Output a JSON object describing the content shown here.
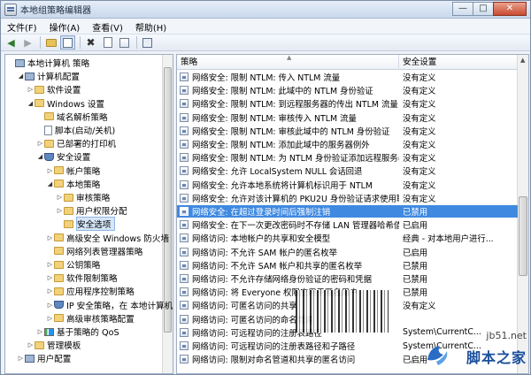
{
  "window": {
    "title": "本地组策略编辑器",
    "controls": {
      "minimize": "—",
      "maximize": "□",
      "close": "✕"
    }
  },
  "menu": [
    "文件(F)",
    "操作(A)",
    "查看(V)",
    "帮助(H)"
  ],
  "toolbar": {
    "icons": [
      "back-arrow-icon",
      "forward-arrow-icon",
      "up-folder-icon",
      "show-tree-icon",
      "delete-icon",
      "properties-icon",
      "export-list-icon",
      "help-icon"
    ]
  },
  "tree": [
    {
      "label": "本地计算机 策略",
      "depth": 0,
      "icon": "computer",
      "expander": ""
    },
    {
      "label": "计算机配置",
      "depth": 1,
      "icon": "computer",
      "expander": "◢"
    },
    {
      "label": "软件设置",
      "depth": 2,
      "icon": "folder",
      "expander": "▷"
    },
    {
      "label": "Windows 设置",
      "depth": 2,
      "icon": "folder",
      "expander": "◢"
    },
    {
      "label": "域名解析策略",
      "depth": 3,
      "icon": "folder",
      "expander": ""
    },
    {
      "label": "脚本(启动/关机)",
      "depth": 3,
      "icon": "doc",
      "expander": ""
    },
    {
      "label": "已部署的打印机",
      "depth": 3,
      "icon": "folder",
      "expander": "▷"
    },
    {
      "label": "安全设置",
      "depth": 3,
      "icon": "shield",
      "expander": "◢"
    },
    {
      "label": "帐户策略",
      "depth": 4,
      "icon": "folder",
      "expander": "▷"
    },
    {
      "label": "本地策略",
      "depth": 4,
      "icon": "folder",
      "expander": "◢"
    },
    {
      "label": "审核策略",
      "depth": 5,
      "icon": "folder",
      "expander": "▷"
    },
    {
      "label": "用户权限分配",
      "depth": 5,
      "icon": "folder",
      "expander": "▷"
    },
    {
      "label": "安全选项",
      "depth": 5,
      "icon": "folder",
      "expander": "",
      "selected": true
    },
    {
      "label": "高级安全 Windows 防火墙",
      "depth": 4,
      "icon": "folder",
      "expander": "▷"
    },
    {
      "label": "网络列表管理器策略",
      "depth": 4,
      "icon": "folder",
      "expander": ""
    },
    {
      "label": "公钥策略",
      "depth": 4,
      "icon": "folder",
      "expander": "▷"
    },
    {
      "label": "软件限制策略",
      "depth": 4,
      "icon": "folder",
      "expander": "▷"
    },
    {
      "label": "应用程序控制策略",
      "depth": 4,
      "icon": "folder",
      "expander": "▷"
    },
    {
      "label": "IP 安全策略，在 本地计算机",
      "depth": 4,
      "icon": "shield",
      "expander": "▷"
    },
    {
      "label": "高级审核策略配置",
      "depth": 4,
      "icon": "folder",
      "expander": "▷"
    },
    {
      "label": "基于策略的 QoS",
      "depth": 3,
      "icon": "chart",
      "expander": "▷"
    },
    {
      "label": "管理模板",
      "depth": 2,
      "icon": "folder",
      "expander": "▷"
    },
    {
      "label": "用户配置",
      "depth": 1,
      "icon": "computer",
      "expander": "▷"
    }
  ],
  "list": {
    "columns": {
      "policy": "策略",
      "setting": "安全设置"
    },
    "rows": [
      {
        "policy": "网络安全: 限制 NTLM: 传入 NTLM 流量",
        "setting": "没有定义"
      },
      {
        "policy": "网络安全: 限制 NTLM: 此域中的 NTLM 身份验证",
        "setting": "没有定义"
      },
      {
        "policy": "网络安全: 限制 NTLM: 到远程服务器的传出 NTLM 流量",
        "setting": "没有定义"
      },
      {
        "policy": "网络安全: 限制 NTLM: 审核传入 NTLM 流量",
        "setting": "没有定义"
      },
      {
        "policy": "网络安全: 限制 NTLM: 审核此域中的 NTLM 身份验证",
        "setting": "没有定义"
      },
      {
        "policy": "网络安全: 限制 NTLM: 添加此域中的服务器例外",
        "setting": "没有定义"
      },
      {
        "policy": "网络安全: 限制 NTLM: 为 NTLM 身份验证添加远程服务器...",
        "setting": "没有定义"
      },
      {
        "policy": "网络安全: 允许 LocalSystem NULL 会话回退",
        "setting": "没有定义"
      },
      {
        "policy": "网络安全: 允许本地系统将计算机标识用于 NTLM",
        "setting": "没有定义"
      },
      {
        "policy": "网络安全: 允许对该计算机的 PKU2U 身份验证请求使用联...",
        "setting": "没有定义"
      },
      {
        "policy": "网络安全: 在超过登录时间后强制注销",
        "setting": "已禁用",
        "selected": true
      },
      {
        "policy": "网络安全: 在下一次更改密码时不存储 LAN 管理器哈希值",
        "setting": "已启用"
      },
      {
        "policy": "网络访问: 本地帐户的共享和安全模型",
        "setting": "经典 - 对本地用户进行..."
      },
      {
        "policy": "网络访问: 不允许 SAM 帐户的匿名枚举",
        "setting": "已启用"
      },
      {
        "policy": "网络访问: 不允许 SAM 帐户和共享的匿名枚举",
        "setting": "已禁用"
      },
      {
        "policy": "网络访问: 不允许存储网络身份验证的密码和凭据",
        "setting": "已禁用"
      },
      {
        "policy": "网络访问: 将 Everyone 权限应用于匿名用户",
        "setting": "已禁用"
      },
      {
        "policy": "网络访问: 可匿名访问的共享",
        "setting": "没有定义"
      },
      {
        "policy": "网络访问: 可匿名访问的命名管道",
        "setting": ""
      },
      {
        "policy": "网络访问: 可远程访问的注册表路径",
        "setting": "System\\CurrentC..."
      },
      {
        "policy": "网络访问: 可远程访问的注册表路径和子路径",
        "setting": "System\\CurrentC..."
      },
      {
        "policy": "网络访问: 限制对命名管道和共享的匿名访问",
        "setting": "已启用"
      }
    ]
  },
  "watermark": {
    "url": "jb51.net",
    "name": "脚本之家"
  }
}
